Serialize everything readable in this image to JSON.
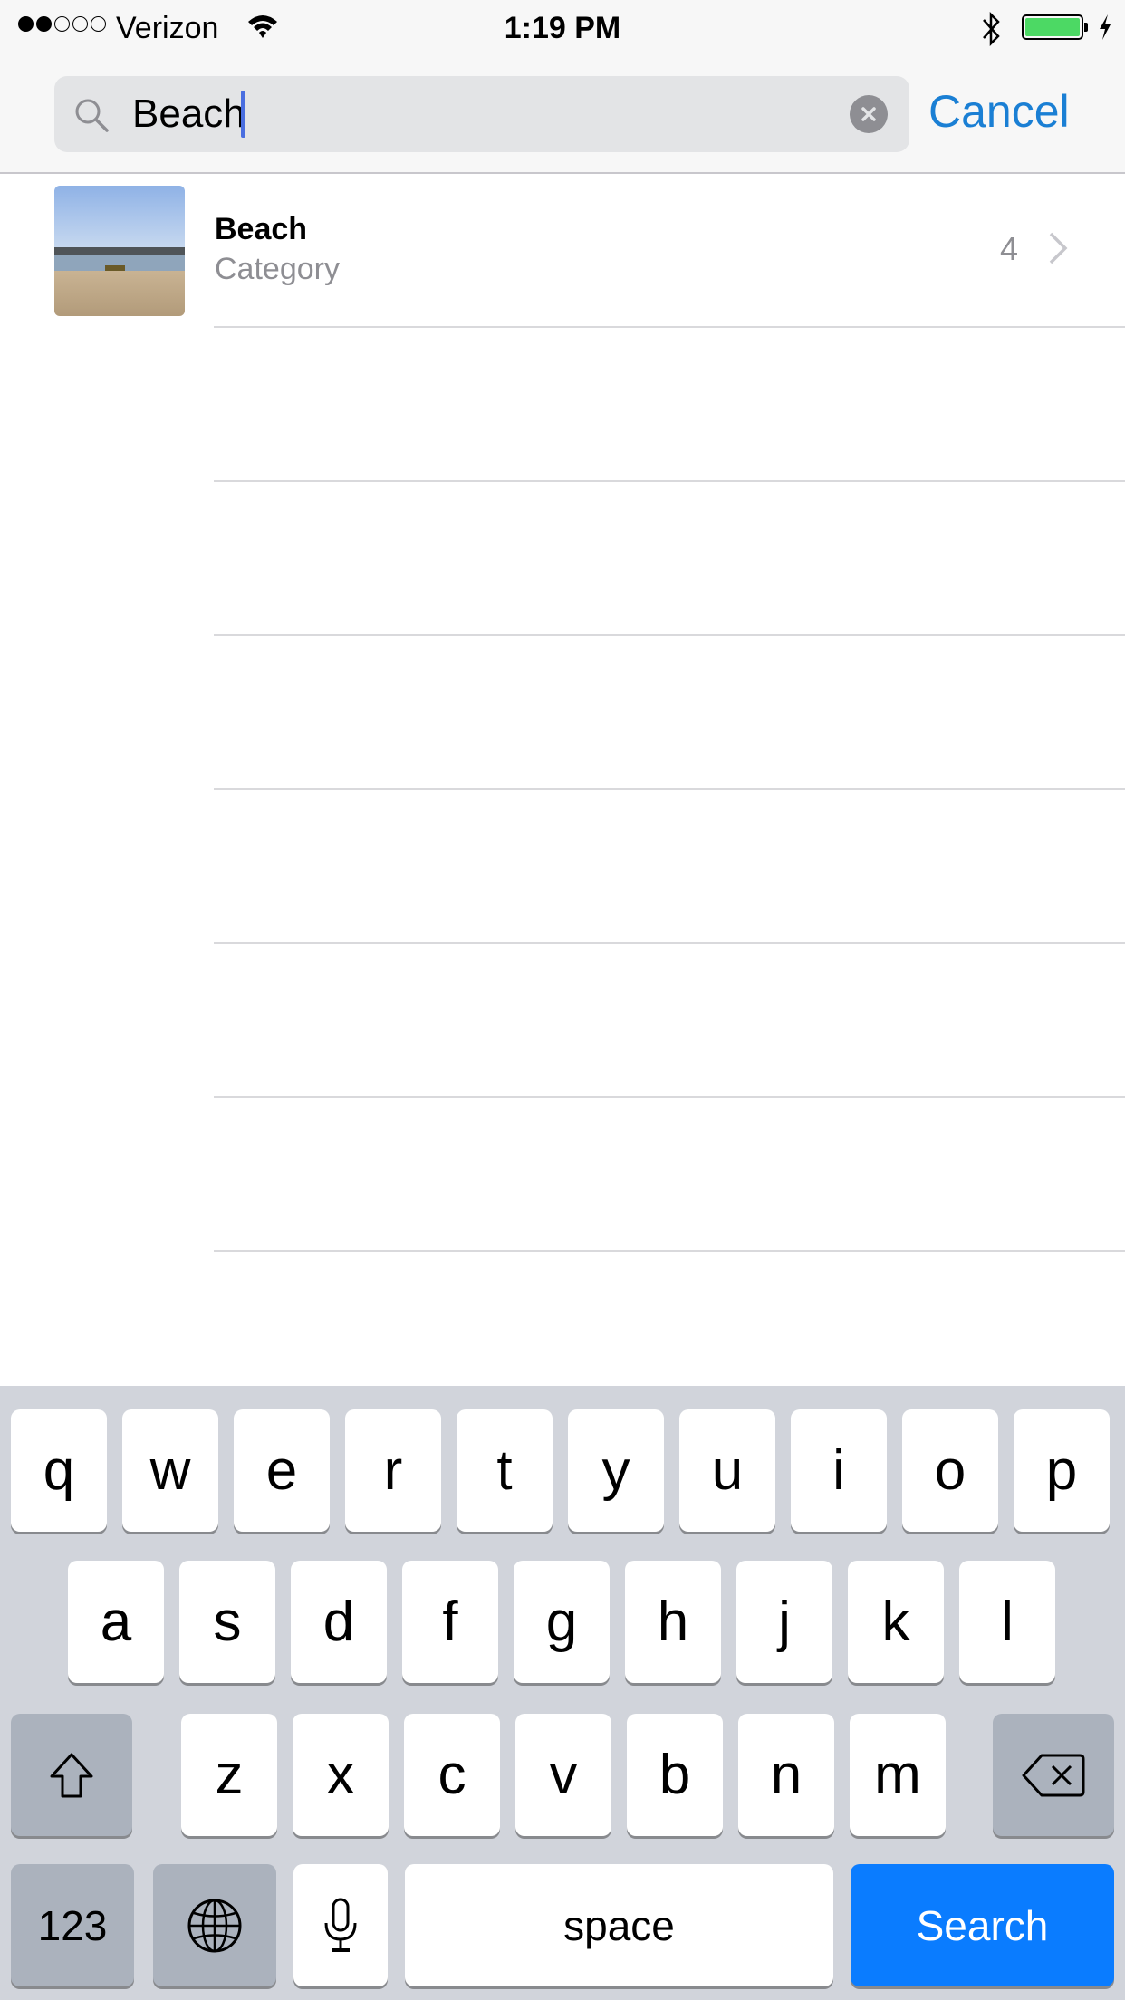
{
  "status_bar": {
    "signal_bars_filled": 2,
    "signal_bars_total": 5,
    "carrier": "Verizon",
    "time": "1:19 PM",
    "battery_color": "#4cd964",
    "icons": [
      "wifi-icon",
      "bluetooth-icon",
      "battery-icon",
      "charging-bolt-icon"
    ]
  },
  "search": {
    "value": "Beach",
    "cancel_label": "Cancel",
    "accent_color": "#1a7fd4"
  },
  "results": [
    {
      "title": "Beach",
      "subtitle": "Category",
      "count": "4",
      "thumbnail": "beach-photo"
    }
  ],
  "keyboard": {
    "row1": [
      "q",
      "w",
      "e",
      "r",
      "t",
      "y",
      "u",
      "i",
      "o",
      "p"
    ],
    "row2": [
      "a",
      "s",
      "d",
      "f",
      "g",
      "h",
      "j",
      "k",
      "l"
    ],
    "row3": [
      "z",
      "x",
      "c",
      "v",
      "b",
      "n",
      "m"
    ],
    "numbers_label": "123",
    "space_label": "space",
    "search_label": "Search",
    "search_color": "#0a7cff"
  }
}
